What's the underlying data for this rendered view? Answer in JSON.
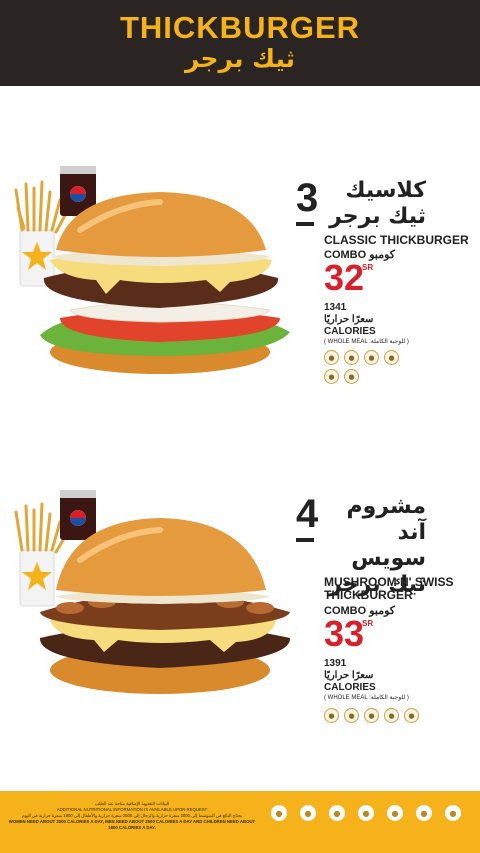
{
  "header": {
    "brand_en": "THICKBURGER",
    "brand_ar": "ثيك برجر"
  },
  "items": [
    {
      "number": "3",
      "name_ar_lines": [
        "كلاسيك",
        "ثيك برجر"
      ],
      "name_en": "CLASSIC THICKBURGER",
      "combo_en": "COMBO",
      "combo_ar": "كومبو",
      "price": "32",
      "currency": "SR",
      "calories": "1341",
      "calories_ar": "سعرًا حراريًا",
      "calories_en": "CALORIES",
      "meal_note": "( WHOLE MEAL :للوجبة الكاملة )",
      "allergen_icons": [
        "wheat-icon",
        "soy-icon",
        "celery-icon",
        "egg-icon",
        "sesame-icon",
        "milk-icon"
      ]
    },
    {
      "number": "4",
      "name_ar_lines": [
        "مشروم آند",
        "سويس",
        "ثيك برجر"
      ],
      "name_en_lines": [
        "MUSHROOM N' SWISS",
        "THICKBURGER"
      ],
      "combo_en": "COMBO",
      "combo_ar": "كومبو",
      "price": "33",
      "currency": "SR",
      "calories": "1391",
      "calories_ar": "سعرًا حراريًا",
      "calories_en": "CALORIES",
      "meal_note": "( WHOLE MEAL :للوجبة الكاملة )",
      "allergen_icons": [
        "sesame-icon",
        "milk-icon",
        "egg-icon",
        "wheat-icon",
        "celery-icon"
      ]
    }
  ],
  "footer": {
    "text_ar_1": "البيانات التغذوية الإضافية متاحة عند الطلب",
    "text_en_1": "ADDITIONAL NUTRITIONAL INFORMATION IS AVAILABLE UPON REQUEST",
    "text_ar_2": "يحتاج البالغ في المتوسط إلى 2000 سعرة حرارية والرجال إلى 2500 سعرة حرارية والأطفال إلى 1800 سعرة حرارية في اليوم",
    "text_en_2": "WOMEN NEED ABOUT 2000 CALORIES A DAY, MEN NEED ABOUT 2500 CALORIES A DAY AND CHILDREN NEED ABOUT 1800 CALORIES A DAY.",
    "legend_icons": [
      "sesame-icon",
      "milk-icon",
      "mustard-icon",
      "celery-icon",
      "egg-icon",
      "soy-icon",
      "wheat-icon"
    ],
    "brand_color": "#f5b21a",
    "header_color": "#2a2522",
    "price_color": "#d8202a"
  }
}
